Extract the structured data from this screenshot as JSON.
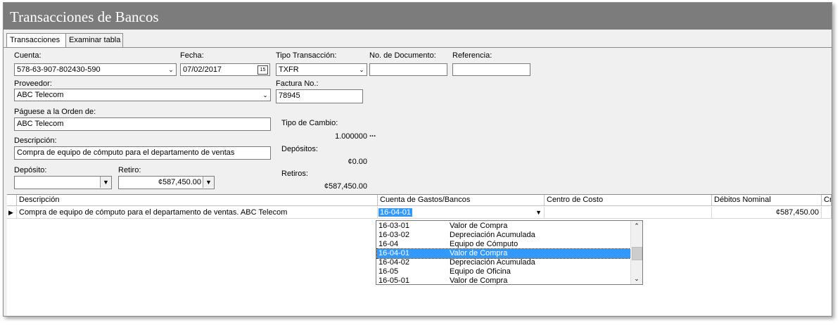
{
  "window": {
    "title": "Transacciones de Bancos"
  },
  "tabs": [
    {
      "label": "Transacciones"
    },
    {
      "label": "Examinar tabla"
    }
  ],
  "form": {
    "cuenta": {
      "label": "Cuenta:",
      "value": "578-63-907-802430-590"
    },
    "fecha": {
      "label": "Fecha:",
      "value": "07/02/2017",
      "cal_icon": "15"
    },
    "tipo_transaccion": {
      "label": "Tipo Transacción:",
      "value": "TXFR"
    },
    "no_documento": {
      "label": "No. de Documento:",
      "value": ""
    },
    "referencia": {
      "label": "Referencia:",
      "value": ""
    },
    "proveedor": {
      "label": "Proveedor:",
      "value": "ABC Telecom"
    },
    "factura": {
      "label": "Factura No.:",
      "value": "78945"
    },
    "paguese": {
      "label": "Páguese a la Orden de:",
      "value": "ABC Telecom"
    },
    "descripcion": {
      "label": "Descripción:",
      "value": "Compra de equipo de cómputo para el departamento de ventas"
    },
    "deposito": {
      "label": "Depósito:",
      "value": ""
    },
    "retiro": {
      "label": "Retiro:",
      "value": "¢587,450.00"
    },
    "tipo_cambio": {
      "label": "Tipo de Cambio:",
      "value": "1.000000",
      "more": "..."
    },
    "depositos": {
      "label": "Depósitos:",
      "value": "¢0.00"
    },
    "retiros": {
      "label": "Retiros:",
      "value": "¢587,450.00"
    }
  },
  "grid": {
    "columns": [
      "Descripción",
      "Cuenta de Gastos/Bancos",
      "Centro de Costo",
      "Débitos Nominal",
      "Cr"
    ],
    "row": {
      "descripcion": "Compra de equipo de cómputo para el departamento de ventas. ABC Telecom",
      "cuenta": "16-04-01",
      "centro": "",
      "debitos": "¢587,450.00"
    }
  },
  "dropdown": {
    "items": [
      {
        "code": "16-03-01",
        "name": "Valor de Compra"
      },
      {
        "code": "16-03-02",
        "name": "Depreciación Acumulada"
      },
      {
        "code": "16-04",
        "name": "Equipo de Cómputo"
      },
      {
        "code": "16-04-01",
        "name": "Valor de Compra",
        "selected": true
      },
      {
        "code": "16-04-02",
        "name": "Depreciación Acumulada"
      },
      {
        "code": "16-05",
        "name": "Equipo de Oficina"
      },
      {
        "code": "16-05-01",
        "name": "Valor de Compra"
      }
    ]
  },
  "colors": {
    "titlebar": "#7c7c7c",
    "selection": "#3399ff",
    "panel": "#f0f0f0"
  },
  "icons": {
    "dropdown": "chevron-down-icon",
    "calendar": "calendar-icon",
    "row_indicator": "row-pointer-icon",
    "scroll_up": "chevron-up-icon",
    "scroll_down": "chevron-down-icon"
  }
}
